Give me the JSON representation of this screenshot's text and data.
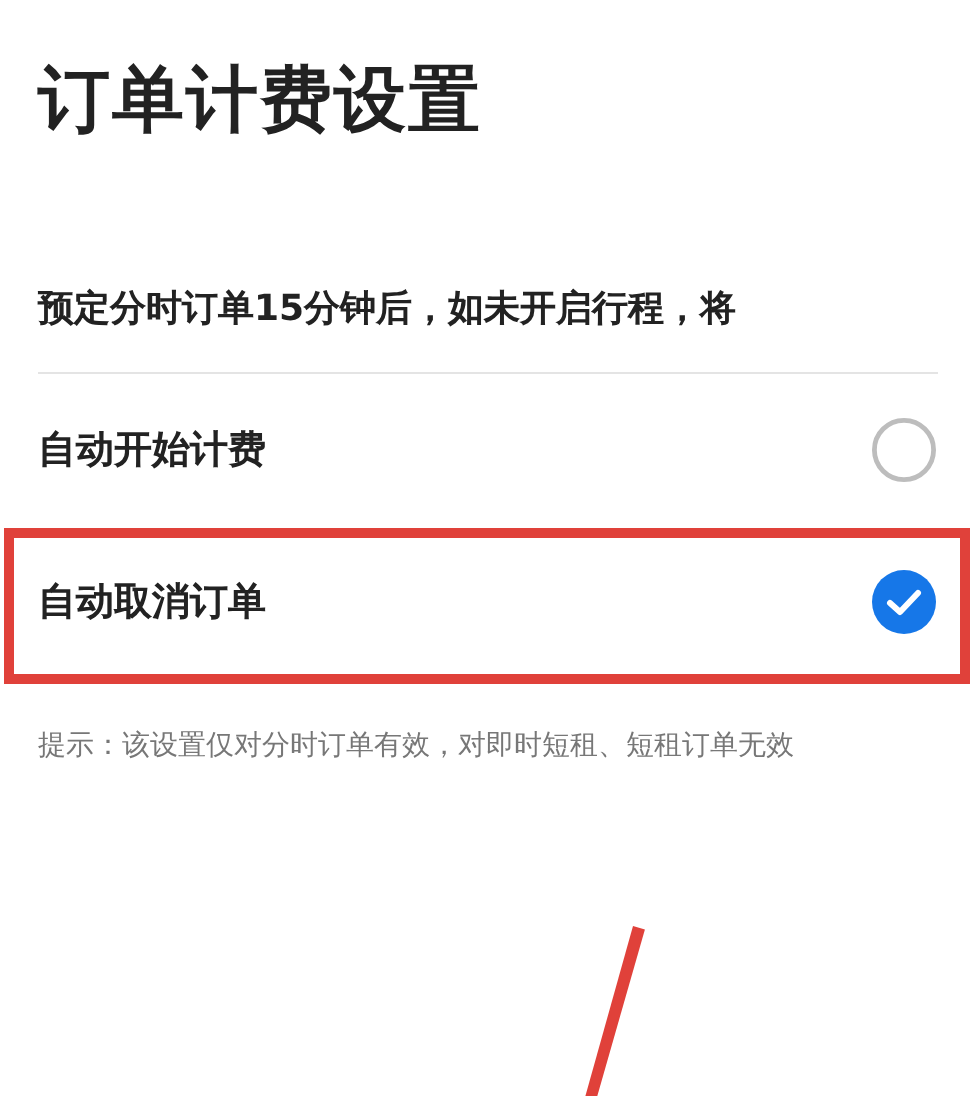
{
  "title": "订单计费设置",
  "question": "预定分时订单15分钟后，如未开启行程，将",
  "options": [
    {
      "label": "自动开始计费",
      "selected": false
    },
    {
      "label": "自动取消订单",
      "selected": true
    }
  ],
  "hint": "提示：该设置仅对分时订单有效，对即时短租、短租订单无效"
}
